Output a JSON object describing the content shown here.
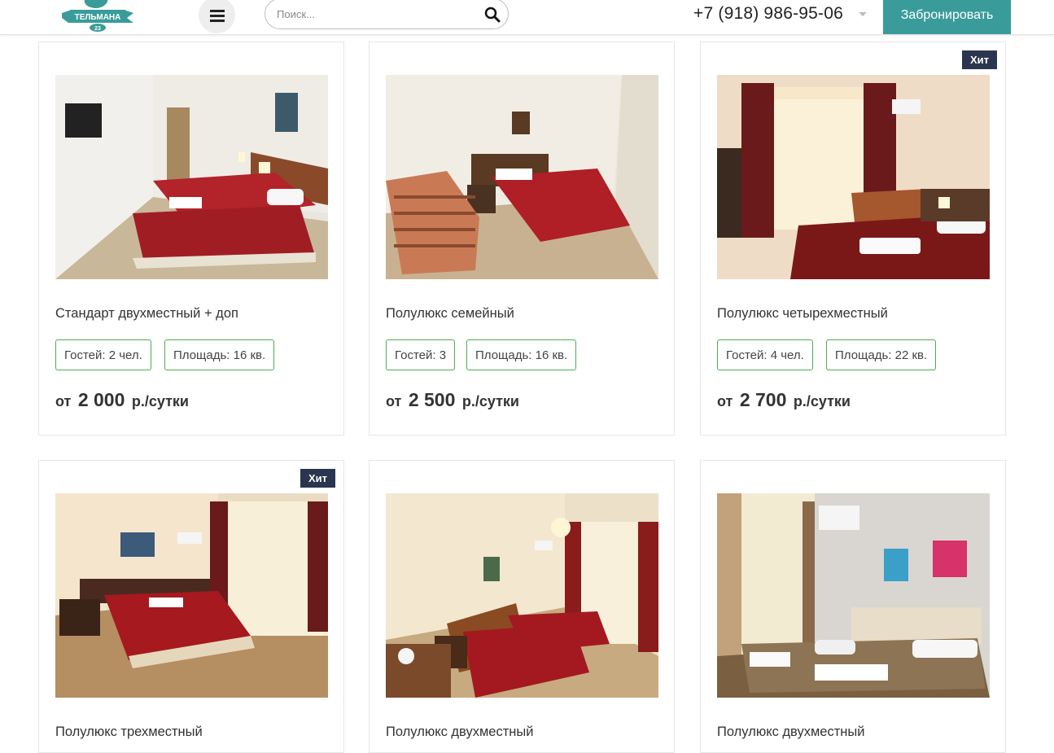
{
  "header": {
    "logo_text": "ТЕЛЬМАНА",
    "logo_number": "23",
    "search_placeholder": "Поиск...",
    "phone": "+7 (918) 986-95-06",
    "book_label": "Забронировать"
  },
  "colors": {
    "accent": "#3a9c9a",
    "tag_border": "#4caf50",
    "hit_badge": "#2a3550"
  },
  "rooms": [
    {
      "title": "Стандарт двухместный + доп",
      "guests": "Гостей: 2 чел.",
      "area": "Площадь: 16 кв.",
      "price_prefix": "от",
      "price": "2 000",
      "price_suffix": "р./сутки",
      "badge": ""
    },
    {
      "title": "Полулюкс семейный",
      "guests": "Гостей: 3",
      "area": "Площадь: 16 кв.",
      "price_prefix": "от",
      "price": "2 500",
      "price_suffix": "р./сутки",
      "badge": ""
    },
    {
      "title": "Полулюкс четырехместный",
      "guests": "Гостей: 4 чел.",
      "area": "Площадь: 22 кв.",
      "price_prefix": "от",
      "price": "2 700",
      "price_suffix": "р./сутки",
      "badge": "Хит"
    },
    {
      "title": "Полулюкс трехместный",
      "badge": "Хит"
    },
    {
      "title": "Полулюкс двухместный",
      "badge": ""
    },
    {
      "title": "Полулюкс двухместный",
      "badge": ""
    }
  ]
}
